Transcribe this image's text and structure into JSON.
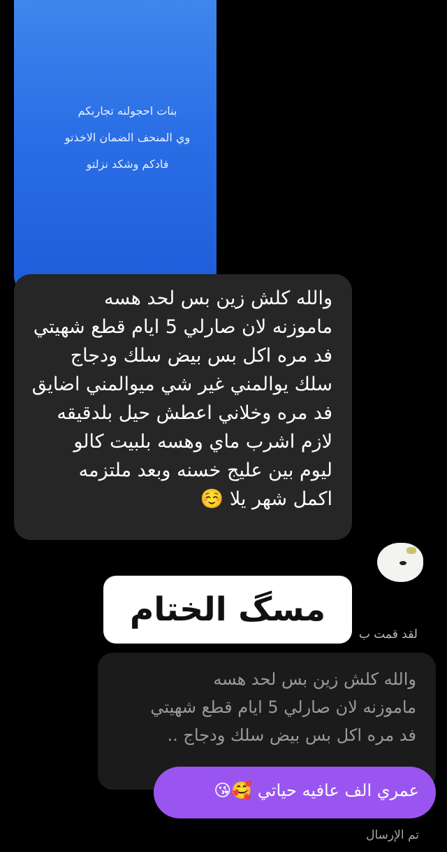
{
  "story": {
    "lines": [
      "بنات احجولنه تجاربكم",
      "وي المنحف الضمان  الاخذتو",
      "فادكم وشكد نزلتو"
    ]
  },
  "message": {
    "lines": [
      "والله كلش زين بس لحد هسه",
      "ماموزنه لان صارلي 5 ايام قطع شهيتي",
      "فد مره اكل بس بيض سلك ودجاج",
      "سلك يوالمني غير شي ميوالمني اضايق",
      "فد مره وخلاني اعطش حيل بلدقيقه",
      "لازم اشرب ماي وهسه بلبيت كالو",
      "ليوم بين عليج خسنه وبعد ملتزمه",
      "اكمل شهر يلا ☺️"
    ]
  },
  "overlay": {
    "title": "مسگ الختام"
  },
  "reply_context": {
    "label": "لقد قمت ب"
  },
  "quoted": {
    "lines": [
      "والله كلش زين بس لحد هسه",
      "ماموزنه لان صارلي 5 ايام قطع شهيتي",
      "فد مره اكل بس بيض سلك ودجاج .."
    ]
  },
  "reply": {
    "text": "عمري الف عافيه حياتي 🥰😘"
  },
  "status": {
    "text": "تم الإرسال"
  }
}
